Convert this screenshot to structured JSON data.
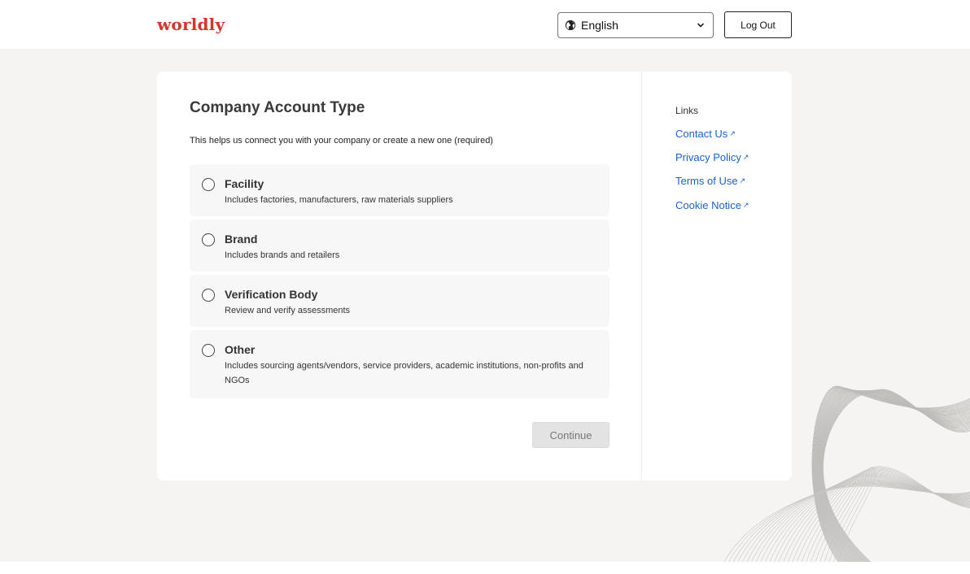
{
  "header": {
    "logo": "worldly",
    "language": {
      "selected": "English"
    },
    "logout_label": "Log Out"
  },
  "main": {
    "title": "Company Account Type",
    "subtitle": "This helps us connect you with your company or create a new one (required)",
    "options": [
      {
        "title": "Facility",
        "description": "Includes factories, manufacturers, raw materials suppliers",
        "selected": false
      },
      {
        "title": "Brand",
        "description": "Includes brands and retailers",
        "selected": false
      },
      {
        "title": "Verification Body",
        "description": "Review and verify assessments",
        "selected": false
      },
      {
        "title": "Other",
        "description": "Includes sourcing agents/vendors, service providers, academic institutions, non-profits and NGOs",
        "selected": false
      }
    ],
    "continue_label": "Continue"
  },
  "sidebar": {
    "heading": "Links",
    "links": [
      {
        "label": "Contact Us",
        "icon": "external-link-icon"
      },
      {
        "label": "Privacy Policy",
        "icon": "external-link-icon"
      },
      {
        "label": "Terms of Use",
        "icon": "external-link-icon"
      },
      {
        "label": "Cookie Notice",
        "icon": "external-link-icon"
      }
    ]
  },
  "colors": {
    "brand": "#d7342a",
    "link": "#1a62c9",
    "page_background": "#f5f4f2"
  },
  "icons": {
    "language": "globe-icon",
    "dropdown": "chevron-down-icon",
    "decoration": "wave-lines-decoration"
  }
}
